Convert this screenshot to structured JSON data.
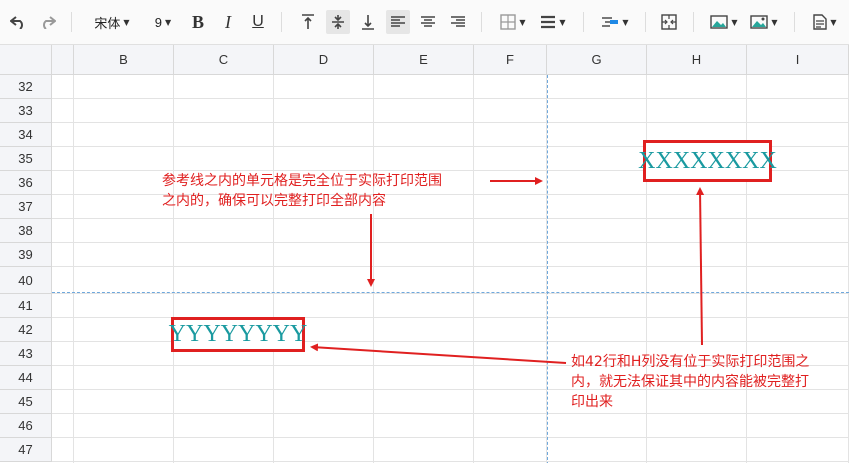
{
  "toolbar": {
    "font_name": "宋体",
    "font_size": "9",
    "bold_label": "B",
    "italic_label": "I",
    "underline_label": "U"
  },
  "columns": [
    "B",
    "C",
    "D",
    "E",
    "F",
    "G",
    "H",
    "I"
  ],
  "rows": [
    "32",
    "33",
    "34",
    "35",
    "36",
    "37",
    "38",
    "39",
    "40",
    "41",
    "42",
    "43",
    "44",
    "45",
    "46",
    "47"
  ],
  "cells": {
    "h35": "XXXXXXXX",
    "c42": "YYYYYYYY"
  },
  "annotations": {
    "note1_line1": "参考线之内的单元格是完全位于实际打印范围",
    "note1_line2": "之内的，确保可以完整打印全部内容",
    "note2_line1": "如42行和H列没有位于实际打印范围之",
    "note2_line2": "内，就无法保证其中的内容能被完整打",
    "note2_line3": "印出来"
  },
  "colors": {
    "annotation": "#e02020",
    "cell_text": "#1a9aa0",
    "print_guide": "#6fa8dc"
  }
}
